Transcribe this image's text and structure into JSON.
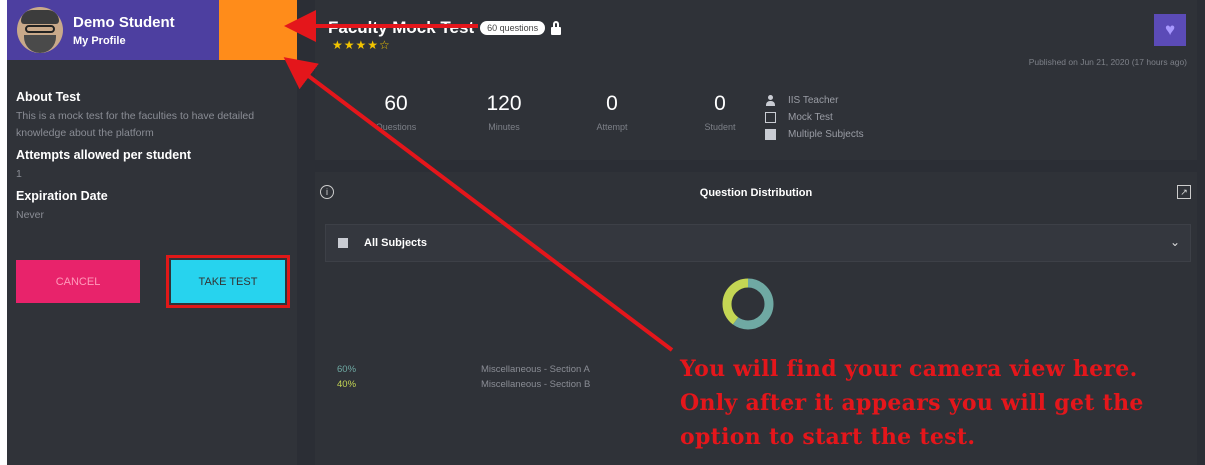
{
  "profile": {
    "name": "Demo Student",
    "link": "My Profile"
  },
  "about": {
    "heading": "About Test",
    "text": "This is a mock test for the faculties to have detailed knowledge about the platform",
    "attempts_heading": "Attempts allowed per student",
    "attempts_value": "1",
    "expiry_heading": "Expiration Date",
    "expiry_value": "Never"
  },
  "buttons": {
    "cancel": "CANCEL",
    "take_test": "TAKE TEST"
  },
  "test": {
    "title": "Faculty Mock Test",
    "questions_badge": "60 questions",
    "rating_stars": "★★★★☆",
    "rating": 4,
    "published": "Published on Jun 21, 2020 (17 hours ago)"
  },
  "stats": [
    {
      "value": "60",
      "label": "Questions"
    },
    {
      "value": "120",
      "label": "Minutes"
    },
    {
      "value": "0",
      "label": "Attempt"
    },
    {
      "value": "0",
      "label": "Student"
    }
  ],
  "meta": [
    {
      "icon": "user-icon",
      "text": "IIS Teacher"
    },
    {
      "icon": "edit-icon",
      "text": "Mock Test"
    },
    {
      "icon": "calculator-icon",
      "text": "Multiple Subjects"
    }
  ],
  "distribution": {
    "title": "Question Distribution",
    "info_glyph": "i",
    "expand_glyph": "↗",
    "select_label": "All Subjects",
    "select_chevron": "⌄",
    "items": [
      {
        "percent": "60%",
        "name": "Miscellaneous - Section A",
        "color": "#6fa9a3"
      },
      {
        "percent": "40%",
        "name": "Miscellaneous - Section B",
        "color": "#c4d654"
      }
    ]
  },
  "annotation": {
    "line1": "You will find your camera view here.",
    "line2": "Only after it appears you will get the",
    "line3": "option to start the test."
  },
  "colors": {
    "accent_purple": "#4d3fa0",
    "orange": "#ff8c1a",
    "cancel_pink": "#e8236b",
    "take_cyan": "#27d3ee",
    "annotation_red": "#e4161b"
  }
}
